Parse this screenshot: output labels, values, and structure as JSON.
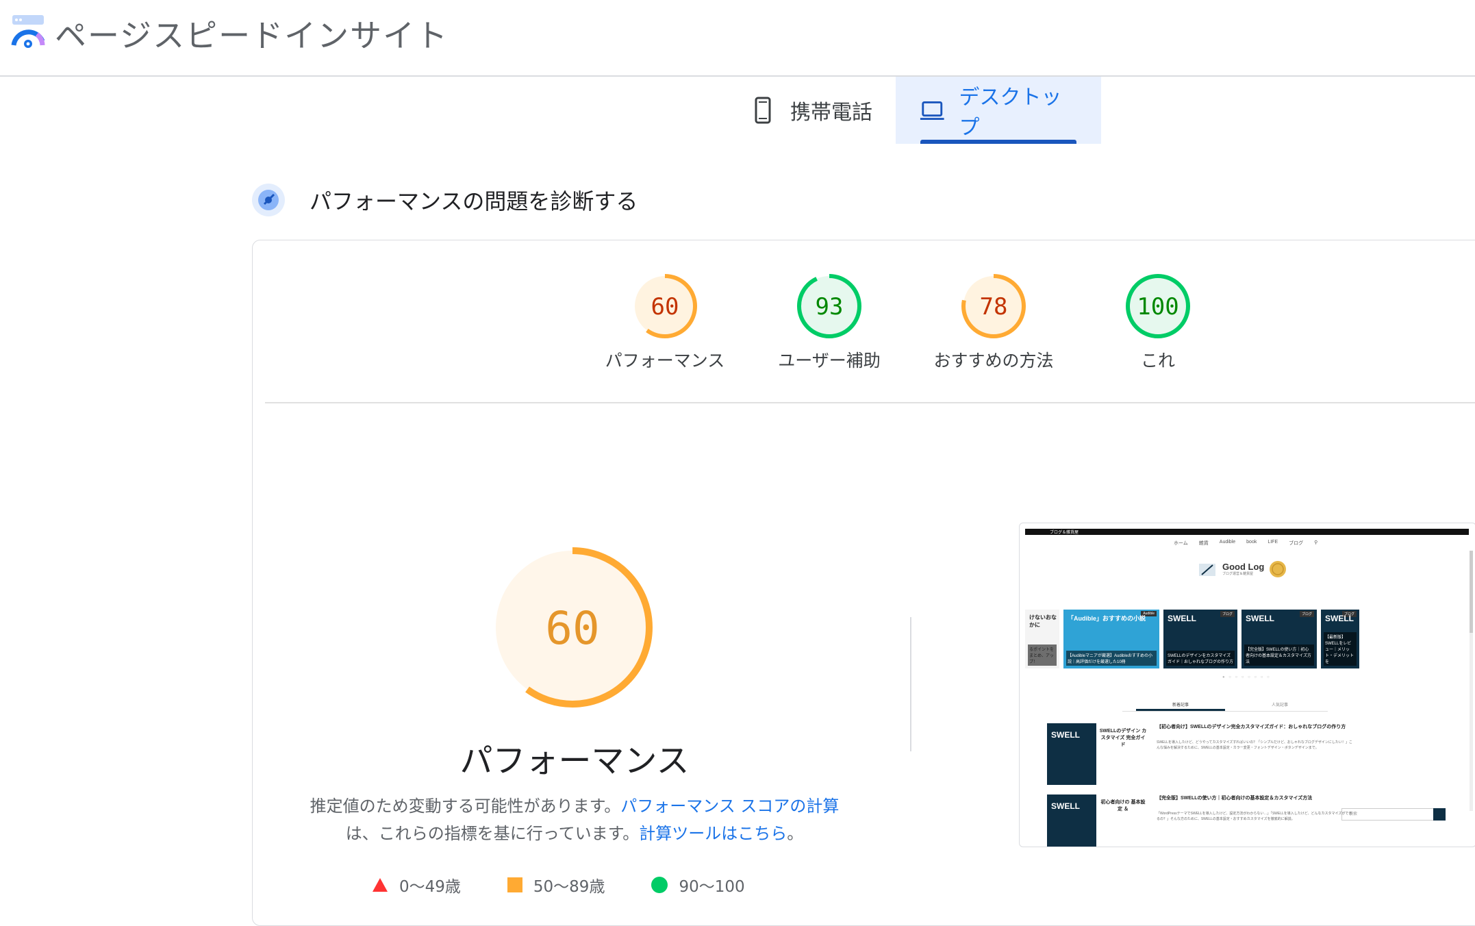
{
  "app": {
    "title": "ページスピードインサイト"
  },
  "tabs": [
    {
      "label": "携帯電話",
      "icon": "phone-icon",
      "active": false
    },
    {
      "label": "デスクトップ",
      "icon": "laptop-icon",
      "active": true
    }
  ],
  "diagnose": {
    "title": "パフォーマンスの問題を診断する",
    "icon": "diagnose-icon"
  },
  "scores": [
    {
      "value": "60",
      "label": "パフォーマンス",
      "color": "#fa3",
      "text_color": "#c33300",
      "fill": "#fff3e0",
      "fraction": 0.6
    },
    {
      "value": "93",
      "label": "ユーザー補助",
      "color": "#0c6",
      "text_color": "#008800",
      "fill": "#e6f8ee",
      "fraction": 0.93
    },
    {
      "value": "78",
      "label": "おすすめの方法",
      "color": "#fa3",
      "text_color": "#c33300",
      "fill": "#fff3e0",
      "fraction": 0.78
    },
    {
      "value": "100",
      "label": "これ",
      "color": "#0c6",
      "text_color": "#008800",
      "fill": "#e6f8ee",
      "fraction": 1.0
    }
  ],
  "main_score": {
    "value": "60",
    "title": "パフォーマンス",
    "fraction": 0.6,
    "color": "#fa3",
    "text_color": "#e5962b",
    "fill": "#fff6ea"
  },
  "description": {
    "text1": "推定値のため変動する可能性があります。",
    "link1": "パフォーマンス スコアの計算",
    "text2": "は、これらの指標を基に行っています。",
    "link2": "計算ツールはこちら",
    "text3": "。"
  },
  "legend": [
    {
      "label": "0〜49歳",
      "shape": "triangle",
      "color": "#ff3333"
    },
    {
      "label": "50〜89歳",
      "shape": "square",
      "color": "#ffaa33"
    },
    {
      "label": "90〜100",
      "shape": "circle",
      "color": "#00cc66"
    }
  ],
  "screenshot": {
    "topbar": "ブログ＆雑貨屋",
    "nav": [
      "ホーム",
      "雑貨",
      "Audible",
      "book",
      "LIFE",
      "ブログ"
    ],
    "brand": "Good Log",
    "brand_sub": "ブログ運営＆雑貨屋",
    "slides": [
      {
        "label": "けないおなかに",
        "tag": "",
        "cap": "るポイントをまとめ、アップ！"
      },
      {
        "label": "「Audible」おすすめの小説",
        "tag": "Audible",
        "cap": "【Audibleマニアが厳選】Audibleおすすめの小説｜高評価だけを厳選した10冊"
      },
      {
        "label": "SWELL",
        "tag": "ブログ",
        "cap": "SWELLのデザインをカスタマイズガイド｜おしゃれなブログの作り方"
      },
      {
        "label": "SWELL",
        "tag": "ブログ",
        "cap": "【完全版】SWELLの使い方｜初心者向けの基本設定＆カスタマイズ方法"
      },
      {
        "label": "SWELL",
        "tag": "ブログ",
        "cap": "【最新版】SWELLをレビュー｜メリット・デメリットを"
      }
    ],
    "tab_new": "新着記事",
    "tab_popular": "人気記事",
    "posts": [
      {
        "thumb": "SWELL",
        "mid": "SWELLのデザイン カスタマイズ 完全ガイド",
        "title": "【初心者向け】SWELLのデザイン完全カスタマイズガイド：おしゃれなブログの作り方",
        "body": "SWELLを導入したけど、どうやってカスタマイズすればいいの？「シンプルだけど、おしゃれなブログデザインにしたい！」こんな悩みを解決するために、SWELLの基本設定・カラー変更・フォントデザイン・ボタンデザインまで。"
      },
      {
        "thumb": "SWELL",
        "mid": "初心者向けの 基本設定 ＆",
        "title": "【完全版】SWELLの使い方｜初心者向けの基本設定＆カスタマイズ方法",
        "body": "「WordPressテーマでSWELLを導入したけど、設定方法がわからない…」「SWELLを導入したけど、どんなカスタマイズができるの？」そんな方のために、SWELLの基本設定・おすすめカスタマイズを徹底的に解説。"
      }
    ],
    "search_placeholder": "検索"
  }
}
